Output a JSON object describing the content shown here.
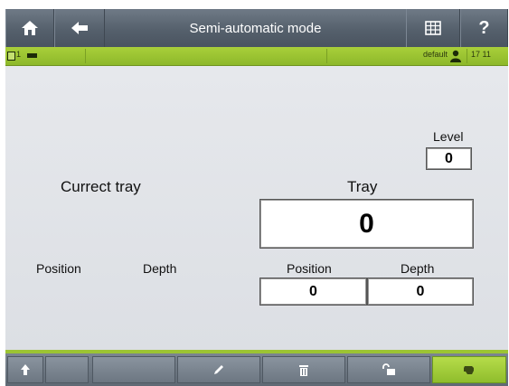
{
  "header": {
    "title": "Semi-automatic mode",
    "home_icon": "home-icon",
    "back_icon": "arrow-left-icon",
    "grid_icon": "grid-table-icon",
    "help_label": "?"
  },
  "status": {
    "station": "1",
    "user": "default",
    "time": "17 11"
  },
  "main": {
    "current_tray_label": "Currect tray",
    "left_position_label": "Position",
    "left_depth_label": "Depth",
    "level_label": "Level",
    "level_value": "0",
    "tray_label": "Tray",
    "tray_value": "0",
    "position_label": "Position",
    "position_value": "0",
    "depth_label": "Depth",
    "depth_value": "0"
  },
  "bottom": {
    "icons": [
      "arrow-up-icon",
      "pencil-icon",
      "trash-icon",
      "unlock-icon",
      "hand-icon"
    ]
  },
  "colors": {
    "header": "#55606c",
    "status_green": "#9cc433",
    "main_bg": "#e0e3e7"
  }
}
